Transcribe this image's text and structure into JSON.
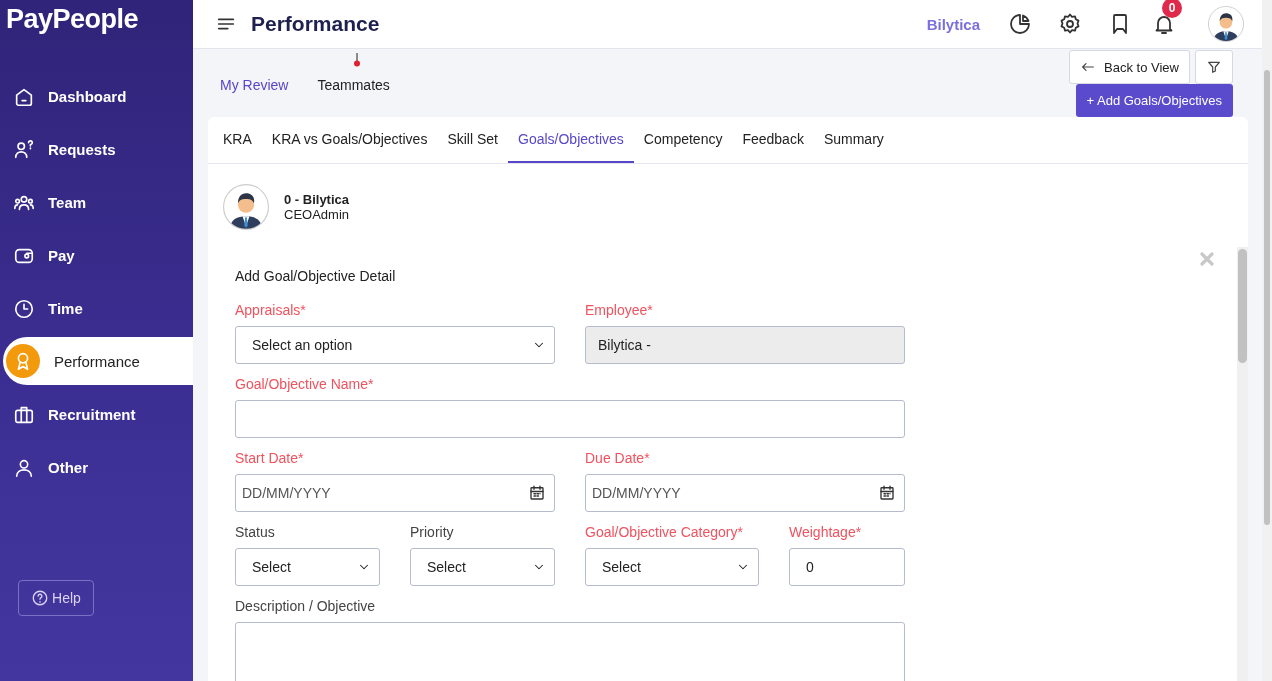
{
  "sidebar": {
    "logo": "PayPeople",
    "items": [
      {
        "label": "Dashboard",
        "selected": false
      },
      {
        "label": "Requests",
        "selected": false
      },
      {
        "label": "Team",
        "selected": false
      },
      {
        "label": "Pay",
        "selected": false
      },
      {
        "label": "Time",
        "selected": false
      },
      {
        "label": "Performance",
        "selected": true
      },
      {
        "label": "Recruitment",
        "selected": false
      },
      {
        "label": "Other",
        "selected": false
      }
    ],
    "help": "Help"
  },
  "header": {
    "title": "Performance",
    "company": "Bilytica",
    "notification_count": "0"
  },
  "sub_tabs": [
    {
      "label": "My Review",
      "selected": true,
      "indicator": false
    },
    {
      "label": "Teammates",
      "selected": false,
      "indicator": true
    }
  ],
  "actions": {
    "back": "Back to View",
    "add": "+ Add Goals/Objectives"
  },
  "tabs": [
    {
      "label": "KRA",
      "selected": false
    },
    {
      "label": "KRA vs Goals/Objectives",
      "selected": false
    },
    {
      "label": "Skill Set",
      "selected": false
    },
    {
      "label": "Goals/Objectives",
      "selected": true
    },
    {
      "label": "Competency",
      "selected": false
    },
    {
      "label": "Feedback",
      "selected": false
    },
    {
      "label": "Summary",
      "selected": false
    }
  ],
  "profile": {
    "name": "0 - Bilytica",
    "role": "CEOAdmin"
  },
  "form": {
    "title": "Add Goal/Objective Detail",
    "rows": [
      [
        {
          "label": "Appraisals*",
          "required": true,
          "kind": "select",
          "value": "Select an option",
          "disabled": false
        },
        {
          "label": "Employee*",
          "required": true,
          "kind": "text",
          "value": "Bilytica -",
          "disabled": true
        }
      ],
      [
        {
          "label": "Goal/Objective Name*",
          "required": true,
          "kind": "text",
          "disabled": false
        }
      ],
      [
        {
          "label": "Start Date*",
          "required": true,
          "kind": "date",
          "placeholder": "DD/MM/YYYY",
          "disabled": false
        },
        {
          "label": "Due Date*",
          "required": true,
          "kind": "date",
          "placeholder": "DD/MM/YYYY",
          "disabled": false
        }
      ],
      [
        {
          "label": "Status",
          "required": false,
          "kind": "select",
          "value": "Select",
          "disabled": false
        },
        {
          "label": "Priority",
          "required": false,
          "kind": "select",
          "value": "Select",
          "disabled": false
        },
        {
          "label": "Goal/Objective Category*",
          "required": true,
          "kind": "select",
          "value": "Select",
          "disabled": false
        },
        {
          "label": "Weightage*",
          "required": true,
          "kind": "text",
          "value": "0",
          "disabled": false
        }
      ],
      [
        {
          "label": "Description / Objective",
          "required": false,
          "kind": "textarea",
          "disabled": false
        }
      ]
    ]
  }
}
